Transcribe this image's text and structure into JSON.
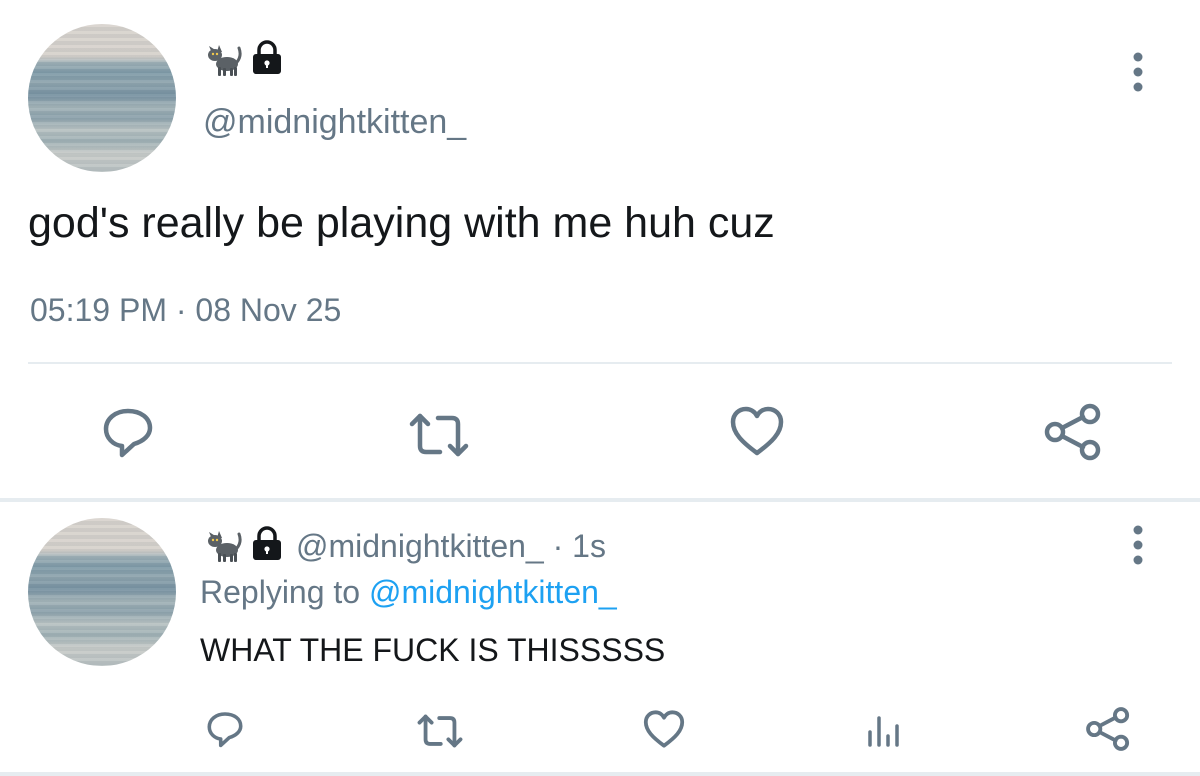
{
  "main_tweet": {
    "handle": "@midnightkitten_",
    "text": "god's really be playing with me huh cuz",
    "timestamp": "05:19 PM · 08 Nov 25",
    "icons": [
      "cat-emoji",
      "lock-icon",
      "more-vertical-icon",
      "reply-icon",
      "retweet-icon",
      "like-icon",
      "share-icon"
    ]
  },
  "reply_tweet": {
    "handle": "@midnightkitten_",
    "time": "· 1s",
    "replying_prefix": "Replying to",
    "replying_handle": "@midnightkitten_",
    "text": "WHAT THE FUCK IS THISSSSS",
    "icons": [
      "cat-emoji",
      "lock-icon",
      "more-vertical-icon",
      "reply-icon",
      "retweet-icon",
      "like-icon",
      "analytics-icon",
      "share-icon"
    ]
  },
  "colors": {
    "text": "#14171a",
    "muted": "#657786",
    "link": "#1da1f2",
    "divider": "#e6ecf0"
  }
}
